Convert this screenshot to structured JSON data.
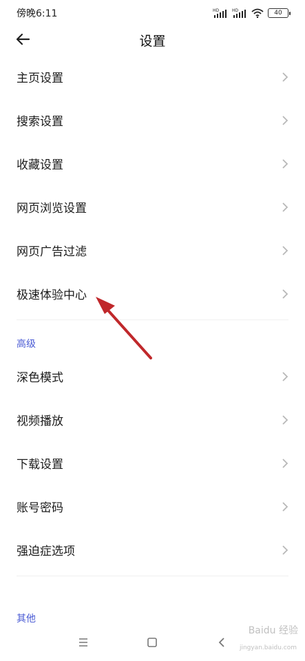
{
  "status": {
    "time": "傍晚6:11",
    "signal1": "HD",
    "signal2": "HD",
    "battery": "40"
  },
  "header": {
    "title": "设置"
  },
  "main_items": [
    {
      "label": "主页设置"
    },
    {
      "label": "搜索设置"
    },
    {
      "label": "收藏设置"
    },
    {
      "label": "网页浏览设置"
    },
    {
      "label": "网页广告过滤"
    },
    {
      "label": "极速体验中心"
    }
  ],
  "advanced": {
    "header": "高级",
    "items": [
      {
        "label": "深色模式"
      },
      {
        "label": "视频播放"
      },
      {
        "label": "下载设置"
      },
      {
        "label": "账号密码"
      },
      {
        "label": "强迫症选项"
      }
    ]
  },
  "other": {
    "header": "其他"
  },
  "nav": {
    "menu_icon": "menu-icon",
    "home_icon": "home-icon",
    "back_icon": "back-icon"
  },
  "annotation": {
    "color": "#c0282b"
  },
  "watermark": {
    "text": "Baidu 经验",
    "sub": "jingyan.baidu.com"
  }
}
